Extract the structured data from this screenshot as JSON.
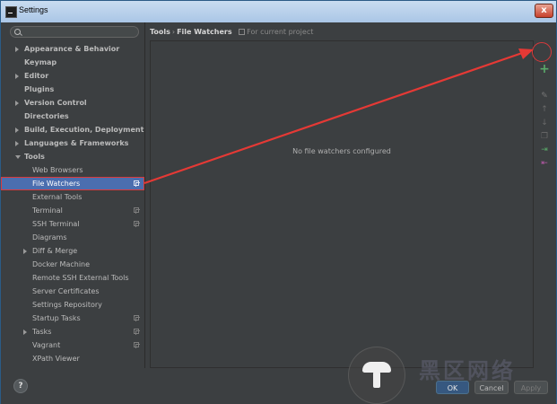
{
  "window": {
    "title": "Settings",
    "close_label": "x"
  },
  "search": {
    "placeholder": ""
  },
  "tree": [
    {
      "label": "Appearance & Behavior",
      "level": 0,
      "arrow": "right"
    },
    {
      "label": "Keymap",
      "level": 0,
      "arrow": "none"
    },
    {
      "label": "Editor",
      "level": 0,
      "arrow": "right"
    },
    {
      "label": "Plugins",
      "level": 0,
      "arrow": "none"
    },
    {
      "label": "Version Control",
      "level": 0,
      "arrow": "right"
    },
    {
      "label": "Directories",
      "level": 0,
      "arrow": "none"
    },
    {
      "label": "Build, Execution, Deployment",
      "level": 0,
      "arrow": "right"
    },
    {
      "label": "Languages & Frameworks",
      "level": 0,
      "arrow": "right"
    },
    {
      "label": "Tools",
      "level": 0,
      "arrow": "down"
    },
    {
      "label": "Web Browsers",
      "level": 1,
      "arrow": "none"
    },
    {
      "label": "File Watchers",
      "level": 1,
      "arrow": "none",
      "selected": true,
      "project": true
    },
    {
      "label": "External Tools",
      "level": 1,
      "arrow": "none"
    },
    {
      "label": "Terminal",
      "level": 1,
      "arrow": "none",
      "project": true
    },
    {
      "label": "SSH Terminal",
      "level": 1,
      "arrow": "none",
      "project": true
    },
    {
      "label": "Diagrams",
      "level": 1,
      "arrow": "none"
    },
    {
      "label": "Diff & Merge",
      "level": 1,
      "arrow": "right"
    },
    {
      "label": "Docker Machine",
      "level": 1,
      "arrow": "none"
    },
    {
      "label": "Remote SSH External Tools",
      "level": 1,
      "arrow": "none"
    },
    {
      "label": "Server Certificates",
      "level": 1,
      "arrow": "none"
    },
    {
      "label": "Settings Repository",
      "level": 1,
      "arrow": "none"
    },
    {
      "label": "Startup Tasks",
      "level": 1,
      "arrow": "none",
      "project": true
    },
    {
      "label": "Tasks",
      "level": 1,
      "arrow": "right",
      "project": true
    },
    {
      "label": "Vagrant",
      "level": 1,
      "arrow": "none",
      "project": true
    },
    {
      "label": "XPath Viewer",
      "level": 1,
      "arrow": "none"
    }
  ],
  "breadcrumb": {
    "parent": "Tools",
    "separator": "›",
    "current": "File Watchers",
    "scope": "For current project"
  },
  "panel": {
    "empty_text": "No file watchers configured"
  },
  "toolbar": {
    "add": "+",
    "edit": "✎",
    "up": "↑",
    "down": "↓",
    "copy": "❐",
    "import": "⇥",
    "export": "⇤"
  },
  "footer": {
    "help": "?",
    "ok": "OK",
    "cancel": "Cancel",
    "apply": "Apply"
  },
  "watermark": {
    "text": "黑区网络"
  },
  "colors": {
    "accent": "#4b6eaf",
    "highlight": "#d9393b",
    "add_green": "#59a869"
  }
}
